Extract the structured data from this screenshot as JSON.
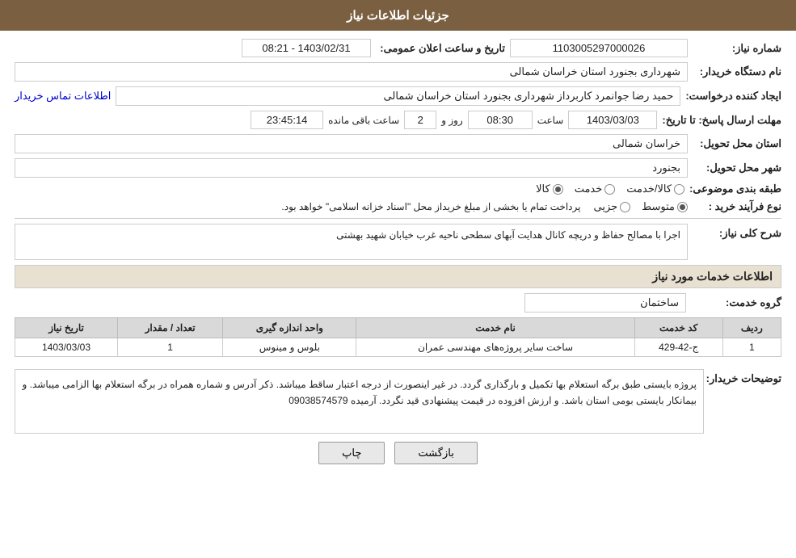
{
  "header": {
    "title": "جزئیات اطلاعات نیاز"
  },
  "form": {
    "need_number_label": "شماره نیاز:",
    "need_number_value": "1103005297000026",
    "announce_date_label": "تاریخ و ساعت اعلان عمومی:",
    "announce_date_value": "1403/02/31 - 08:21",
    "buyer_org_label": "نام دستگاه خریدار:",
    "buyer_org_value": "شهرداری بجنورد استان خراسان شمالی",
    "creator_label": "ایجاد کننده درخواست:",
    "creator_value": "حمید رضا جوانمرد کاربرداز شهرداری بجنورد استان خراسان شمالی",
    "contact_link": "اطلاعات تماس خریدار",
    "reply_deadline_label": "مهلت ارسال پاسخ: تا تاریخ:",
    "reply_date": "1403/03/03",
    "reply_time_label": "ساعت",
    "reply_time": "08:30",
    "reply_days_label": "روز و",
    "reply_days": "2",
    "reply_remaining_label": "ساعت باقی مانده",
    "reply_remaining": "23:45:14",
    "delivery_province_label": "استان محل تحویل:",
    "delivery_province_value": "خراسان شمالی",
    "delivery_city_label": "شهر محل تحویل:",
    "delivery_city_value": "بجنورد",
    "category_label": "طبقه بندی موضوعی:",
    "category_options": [
      {
        "label": "کالا",
        "selected": false
      },
      {
        "label": "خدمت",
        "selected": false
      },
      {
        "label": "کالا/خدمت",
        "selected": false
      }
    ],
    "purchase_type_label": "نوع فرآیند خرید :",
    "purchase_type_options": [
      {
        "label": "جزیی",
        "selected": false
      },
      {
        "label": "متوسط",
        "selected": false
      }
    ],
    "purchase_type_note": "پرداخت تمام یا بخشی از مبلغ خریداز محل \"اسناد خزانه اسلامی\" خواهد بود.",
    "description_label": "شرح کلی نیاز:",
    "description_value": "اجرا با مصالح حفاظ و دریچه کانال هدایت آبهای سطحی ناحیه غرب خیابان شهید بهشتی",
    "services_title": "اطلاعات خدمات مورد نیاز",
    "service_group_label": "گروه خدمت:",
    "service_group_value": "ساختمان",
    "table": {
      "headers": [
        "ردیف",
        "کد خدمت",
        "نام خدمت",
        "واحد اندازه گیری",
        "تعداد / مقدار",
        "تاریخ نیاز"
      ],
      "rows": [
        {
          "row": "1",
          "service_code": "ج-42-429",
          "service_name": "ساخت سایر پروژه‌های مهندسی عمران",
          "unit": "بلوس و مینوس",
          "quantity": "1",
          "date": "1403/03/03"
        }
      ]
    },
    "notes_label": "توضیحات خریدار:",
    "notes_value": "پروژه بایستی طبق برگه استعلام بها  تکمیل و بارگذاری گردد. در غیر اینصورت از درجه اعتبار ساقط میباشد. ذکر آدرس و شماره همراه در برگه استعلام بها الزامی میباشد. و بیمانکار بایستی بومی استان باشد. و ارزش افزوده در قیمت پیشنهادی قید نگردد. آرمیده 09038574579",
    "btn_back": "بازگشت",
    "btn_print": "چاپ"
  }
}
